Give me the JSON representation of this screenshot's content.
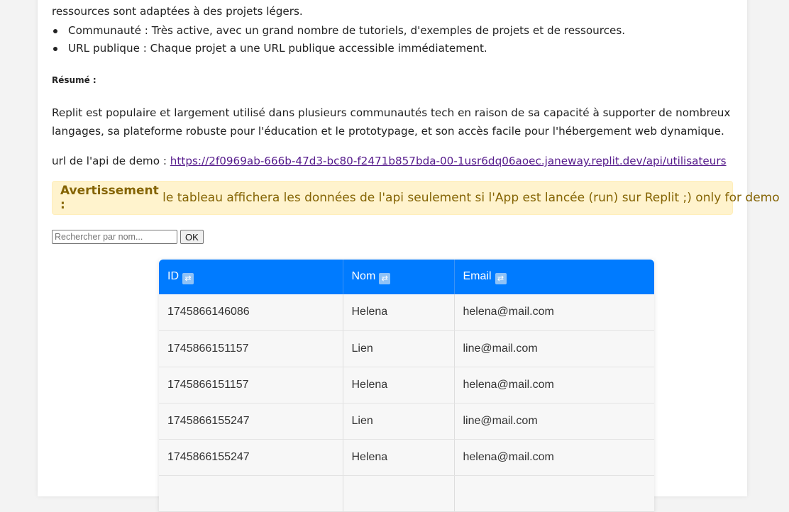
{
  "intro": {
    "line_top": "ressources sont adaptées à des projets légers.",
    "bullets": [
      "Communauté : Très active, avec un grand nombre de tutoriels, d'exemples de projets et de ressources.",
      "URL publique : Chaque projet a une URL publique accessible immédiatement."
    ]
  },
  "summary": {
    "heading": "Résumé :",
    "text": "Replit est populaire et largement utilisé dans plusieurs communautés tech en raison de sa capacité à supporter de nombreux langages, sa plateforme robuste pour l'éducation et le prototypage, et son accès facile pour l'hébergement web dynamique."
  },
  "api": {
    "label": "url de l'api de demo : ",
    "link": "https://2f0969ab-666b-47d3-bc80-f2471b857bda-00-1usr6dq06aoec.janeway.replit.dev/api/utilisateurs"
  },
  "alert": {
    "strong": "Avertissement :",
    "text": " le tableau affichera les données de l'api seulement si l'App est lancée (run) sur Replit ;) only for demo"
  },
  "search": {
    "placeholder": "Rechercher par nom...",
    "button": "OK"
  },
  "table": {
    "headers": [
      "ID",
      "Nom",
      "Email"
    ],
    "sort_icon": "sort-toggle-icon",
    "rows": [
      [
        "1745866146086",
        "Helena",
        "helena@mail.com"
      ],
      [
        "1745866151157",
        "Lien",
        "line@mail.com"
      ],
      [
        "1745866151157",
        "Helena",
        "helena@mail.com"
      ],
      [
        "1745866155247",
        "Lien",
        "line@mail.com"
      ],
      [
        "1745866155247",
        "Helena",
        "helena@mail.com"
      ]
    ]
  },
  "colors": {
    "header_blue": "#007bff",
    "alert_bg": "#fff3cd",
    "alert_text": "#856404"
  }
}
